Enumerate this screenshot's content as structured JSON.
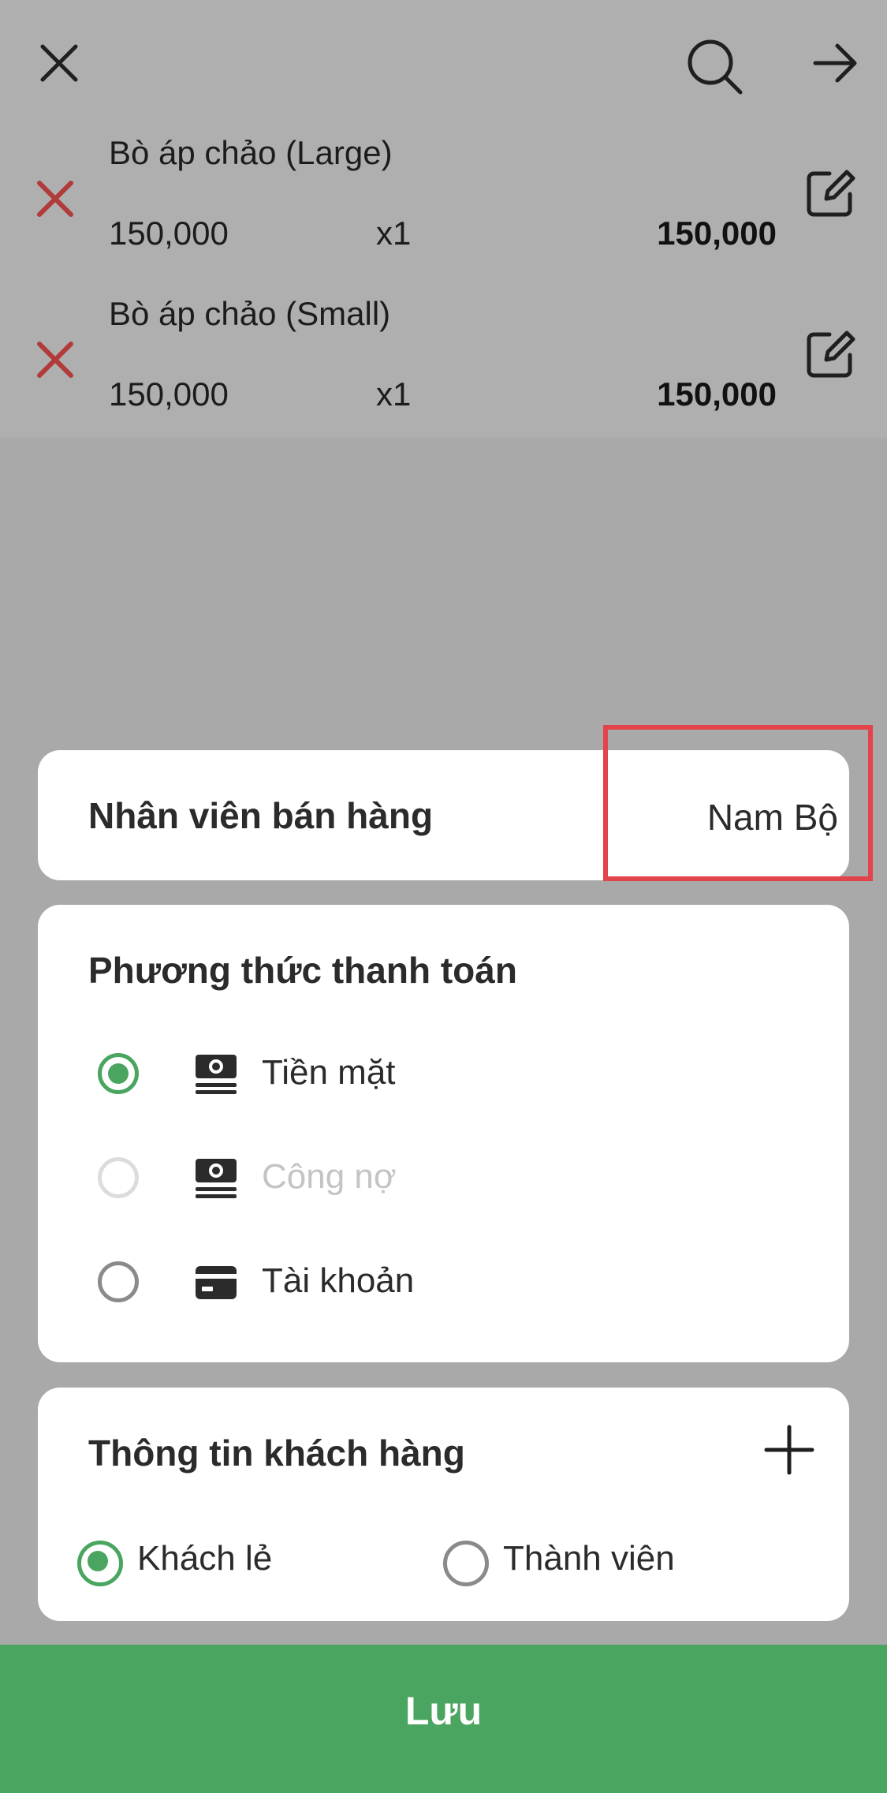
{
  "header": {
    "close_icon": "close-icon",
    "search_icon": "search-icon",
    "forward_icon": "arrow-right-icon"
  },
  "order_items": [
    {
      "name": "Bò áp chảo (Large)",
      "price": "150,000",
      "qty": "x1",
      "total": "150,000"
    },
    {
      "name": "Bò áp chảo (Small)",
      "price": "150,000",
      "qty": "x1",
      "total": "150,000"
    }
  ],
  "seller": {
    "label": "Nhân viên bán hàng",
    "value": "Nam Bộ"
  },
  "payment": {
    "title": "Phương thức thanh toán",
    "options": [
      {
        "label": "Tiền mặt",
        "icon": "cash-icon",
        "selected": true,
        "disabled": false
      },
      {
        "label": "Công nợ",
        "icon": "cash-icon",
        "selected": false,
        "disabled": true
      },
      {
        "label": "Tài khoản",
        "icon": "card-icon",
        "selected": false,
        "disabled": false
      }
    ]
  },
  "customer": {
    "title": "Thông tin khách hàng",
    "add_icon": "plus-icon",
    "options": [
      {
        "label": "Khách lẻ",
        "selected": true
      },
      {
        "label": "Thành viên",
        "selected": false
      }
    ]
  },
  "save": {
    "label": "Lưu"
  },
  "colors": {
    "accent": "#49a55f",
    "remove": "#b23a3a",
    "highlight": "#e3434b",
    "overlay": "#a9a9a9"
  }
}
